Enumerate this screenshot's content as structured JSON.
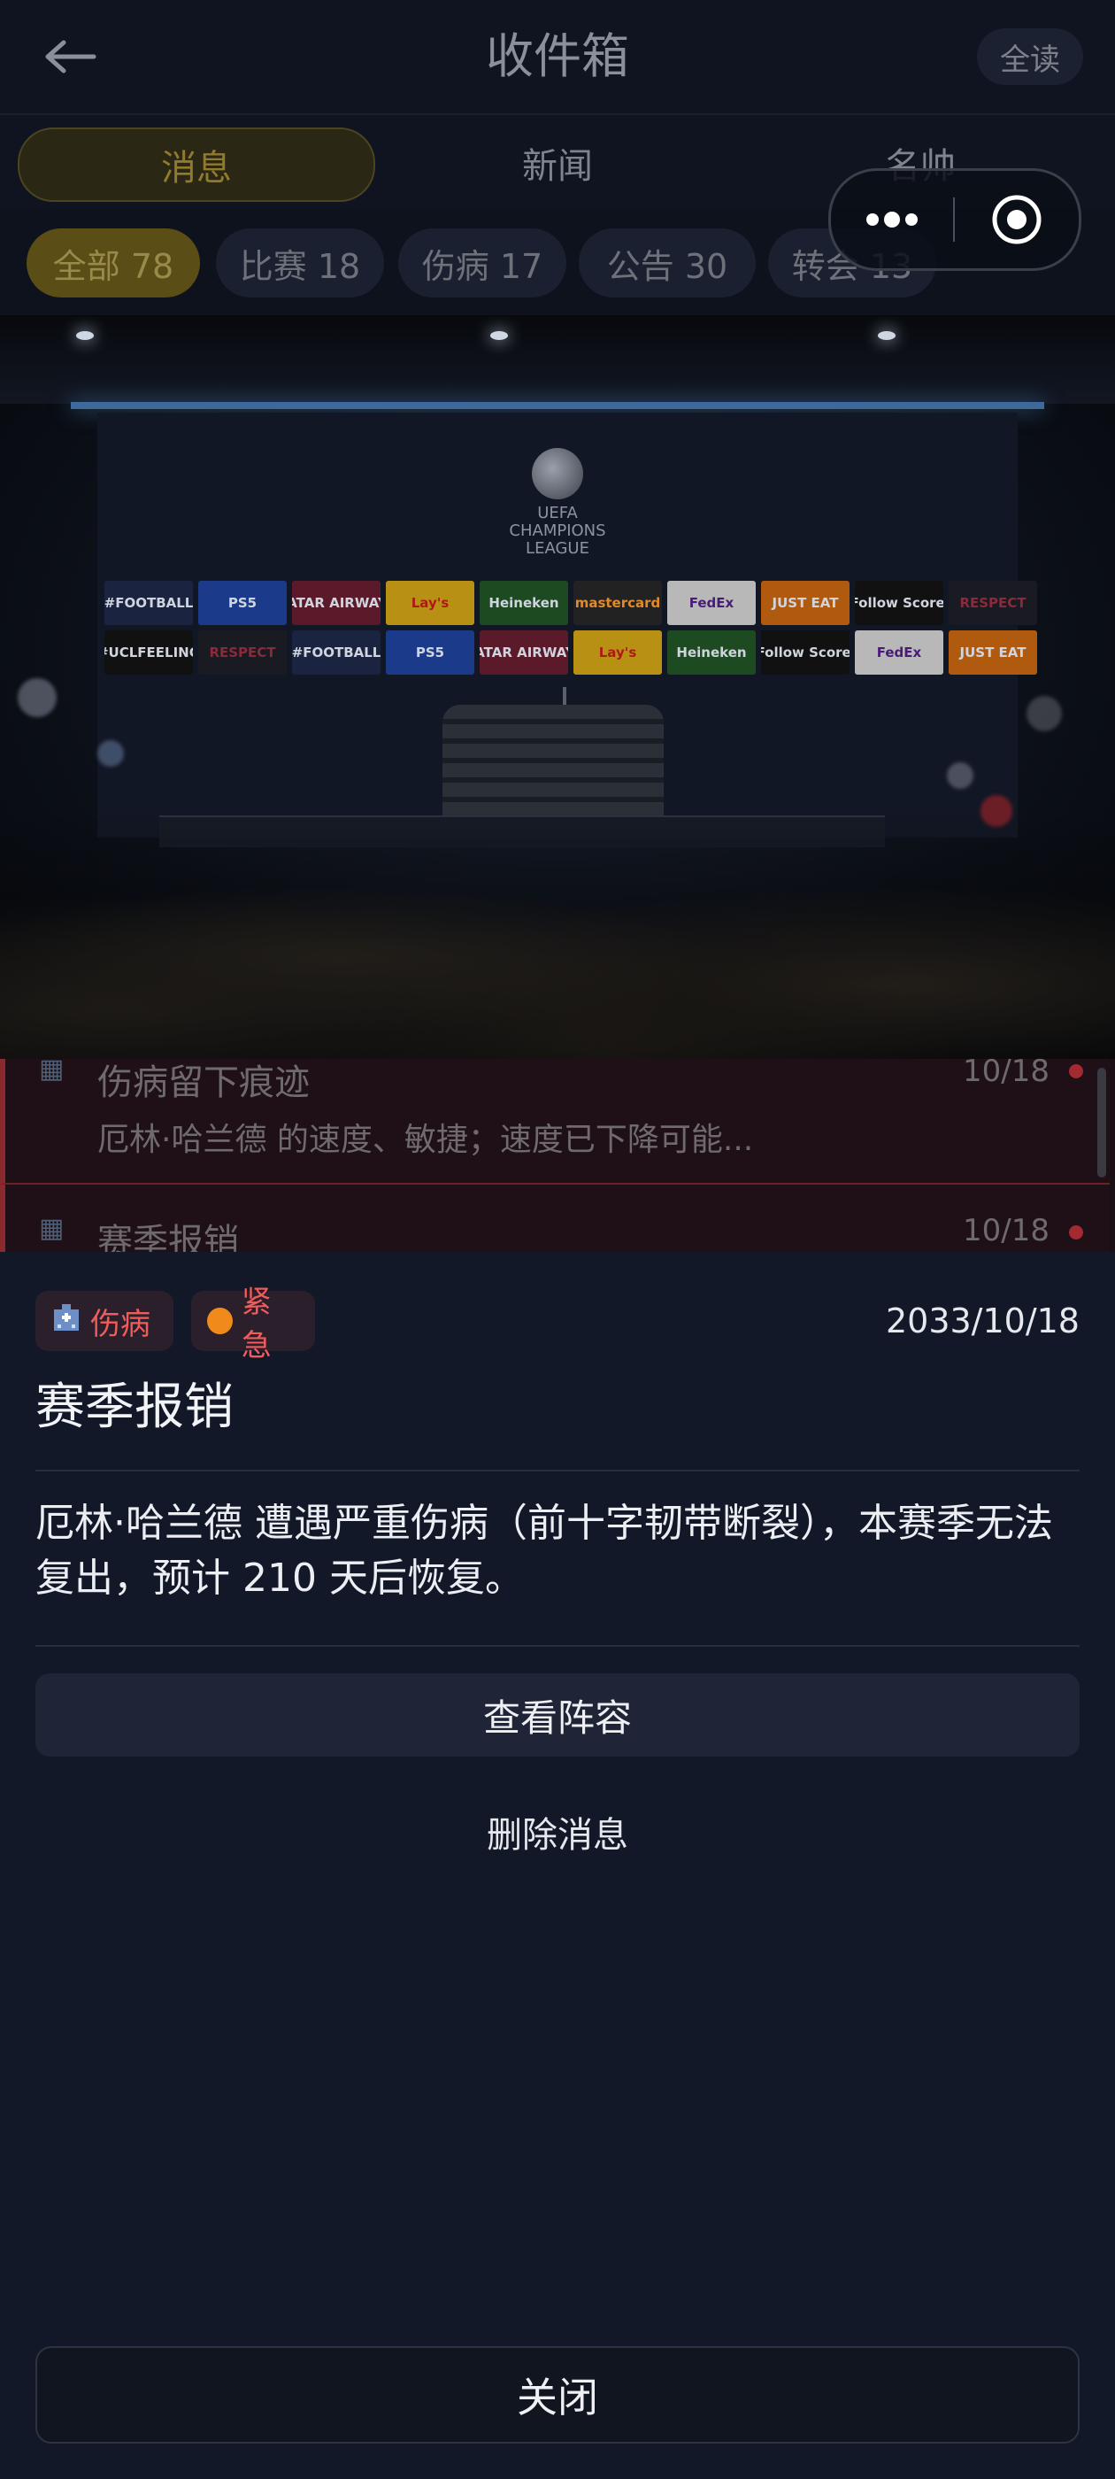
{
  "header": {
    "title": "收件箱",
    "read_all": "全读"
  },
  "tabs": [
    {
      "label": "消息"
    },
    {
      "label": "新闻"
    },
    {
      "label": "名帅"
    }
  ],
  "filters": [
    {
      "label": "全部 78"
    },
    {
      "label": "比赛 18"
    },
    {
      "label": "伤病 17"
    },
    {
      "label": "公告 30"
    },
    {
      "label": "转会 13"
    }
  ],
  "hero": {
    "ucl_text": "UEFA CHAMPIONS LEAGUE",
    "sponsors": [
      "#FOOTBALL",
      "PS5",
      "QATAR AIRWAYS",
      "Lay's",
      "Heineken",
      "mastercard",
      "FedEx",
      "JUST EAT",
      "iFollow Scores",
      "RESPECT",
      "#UCLFEELING",
      "RESPECT",
      "#FOOTBALL",
      "PS5",
      "QATAR AIRWAYS",
      "Lay's",
      "Heineken",
      "iFollow Scores",
      "FedEx",
      "JUST EAT"
    ]
  },
  "list": [
    {
      "title": "伤病留下痕迹",
      "desc": "厄林·哈兰德 的速度、敏捷；速度已下降可能...",
      "date": "10/18"
    },
    {
      "title": "赛季报销",
      "date": "10/18"
    }
  ],
  "detail": {
    "tag_category": "伤病",
    "tag_priority": "紧急",
    "date": "2033/10/18",
    "title": "赛季报销",
    "body": "厄林·哈兰德 遭遇严重伤病（前十字韧带断裂），本赛季无法复出，预计 210 天后恢复。",
    "view_lineup": "查看阵容",
    "delete": "删除消息",
    "close": "关闭"
  },
  "colors": {
    "accent_gold": "#8f7a2e",
    "alert_red": "#ef5c5c",
    "urgent_orange": "#f08a1a",
    "sheet_bg": "#121828"
  },
  "icons": [
    "back-arrow-icon",
    "more-dots-icon",
    "target-close-icon",
    "hospital-icon"
  ]
}
